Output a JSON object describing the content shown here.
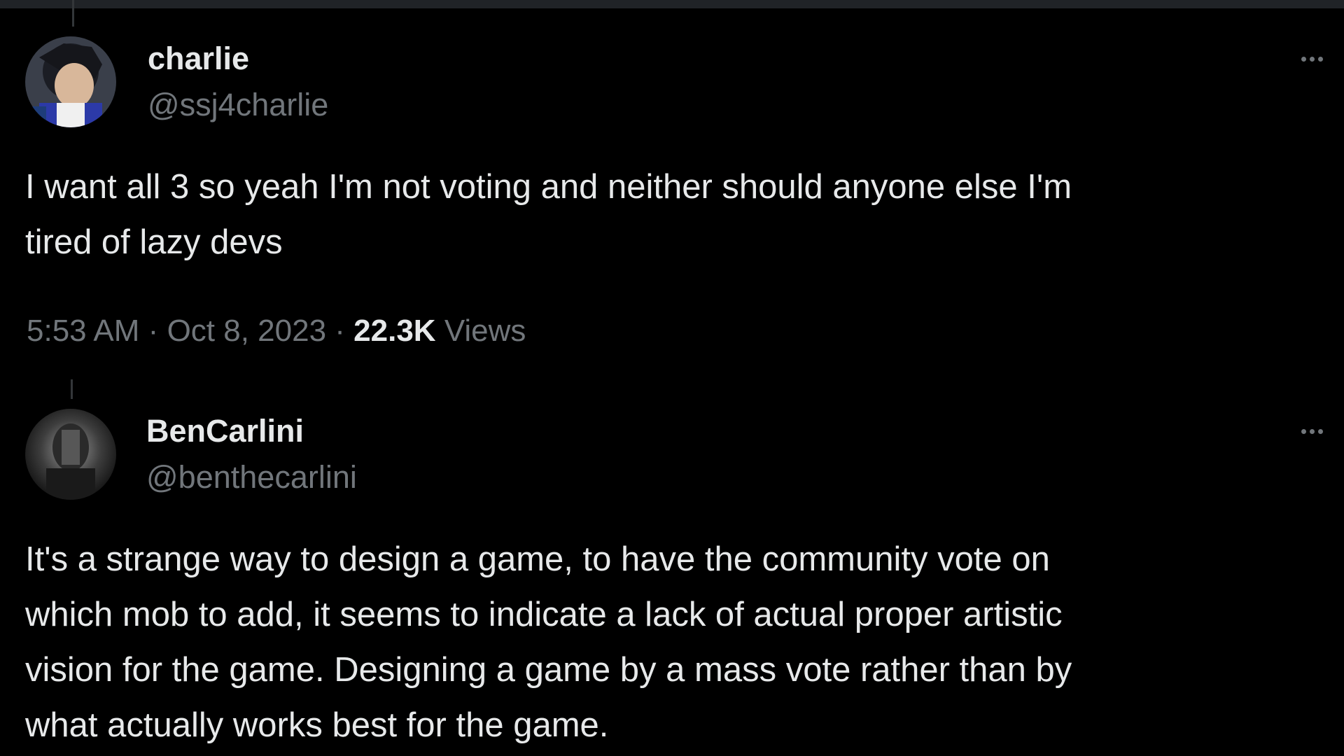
{
  "tweets": [
    {
      "display_name": "charlie",
      "handle": "@ssj4charlie",
      "text_lines": [
        "I want all 3 so yeah I'm not voting and neither should anyone else I'm",
        "tired of lazy devs"
      ],
      "time": "5:53 AM",
      "separator": "·",
      "date": "Oct 8, 2023",
      "views_count": "22.3K",
      "views_label": "Views",
      "more_icon": "more-horizontal-icon"
    },
    {
      "display_name": "BenCarlini",
      "handle": "@benthecarlini",
      "text_lines": [
        "It's a strange way to design a game, to have the community vote on",
        "which mob to add, it seems to indicate a lack of actual proper artistic",
        "vision for the game. Designing a game by a mass vote rather than by",
        "what actually works best for the game."
      ],
      "more_icon": "more-horizontal-icon"
    }
  ],
  "colors": {
    "background": "#000000",
    "primary_text": "#e7e9ea",
    "secondary_text": "#71767b",
    "divider": "#333639"
  }
}
